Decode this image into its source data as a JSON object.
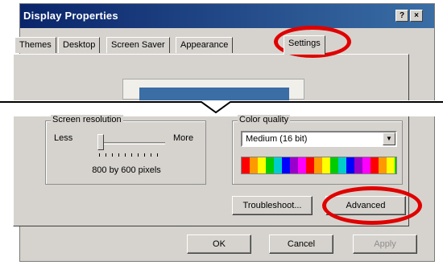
{
  "window": {
    "title": "Display Properties",
    "help_button": "?",
    "close_button": "×"
  },
  "tabs": [
    {
      "label": "Themes"
    },
    {
      "label": "Desktop"
    },
    {
      "label": "Screen Saver"
    },
    {
      "label": "Appearance"
    },
    {
      "label": "Settings"
    }
  ],
  "screen_resolution": {
    "group_label": "Screen resolution",
    "less_label": "Less",
    "more_label": "More",
    "value": "800 by 600 pixels"
  },
  "color_quality": {
    "group_label": "Color quality",
    "selected": "Medium (16 bit)"
  },
  "buttons": {
    "troubleshoot": "Troubleshoot...",
    "advanced": "Advanced",
    "ok": "OK",
    "cancel": "Cancel",
    "apply": "Apply"
  },
  "colors": {
    "annotation_ring": "#e00000",
    "titlebar": "#0a246a",
    "dialog_background": "#d6d3ce"
  }
}
